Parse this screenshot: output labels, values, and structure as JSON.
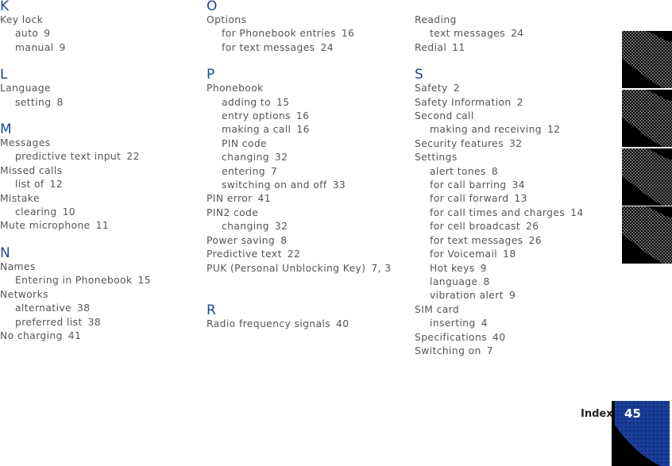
{
  "columns": [
    {
      "sections": [
        {
          "letter": "K",
          "entries": [
            {
              "text": "Key lock",
              "page": "",
              "level": 0
            },
            {
              "text": "auto",
              "page": "9",
              "level": 1
            },
            {
              "text": "manual",
              "page": "9",
              "level": 1
            }
          ]
        },
        {
          "letter": "L",
          "entries": [
            {
              "text": "Language",
              "page": "",
              "level": 0
            },
            {
              "text": "setting",
              "page": "8",
              "level": 1
            }
          ]
        },
        {
          "letter": "M",
          "entries": [
            {
              "text": "Messages",
              "page": "",
              "level": 0
            },
            {
              "text": "predictive text input",
              "page": "22",
              "level": 1
            },
            {
              "text": "Missed calls",
              "page": "",
              "level": 0
            },
            {
              "text": "list of",
              "page": "12",
              "level": 1
            },
            {
              "text": "Mistake",
              "page": "",
              "level": 0
            },
            {
              "text": "clearing",
              "page": "10",
              "level": 1
            },
            {
              "text": "Mute microphone",
              "page": "11",
              "level": 0
            }
          ]
        },
        {
          "letter": "N",
          "entries": [
            {
              "text": "Names",
              "page": "",
              "level": 0
            },
            {
              "text": "Entering in Phonebook",
              "page": "15",
              "level": 1
            },
            {
              "text": "Networks",
              "page": "",
              "level": 0
            },
            {
              "text": "alternative",
              "page": "38",
              "level": 1
            },
            {
              "text": "preferred list",
              "page": "38",
              "level": 1
            },
            {
              "text": "No charging",
              "page": "41",
              "level": 0
            }
          ]
        }
      ]
    },
    {
      "sections": [
        {
          "letter": "O",
          "entries": [
            {
              "text": "Options",
              "page": "",
              "level": 0
            },
            {
              "text": "for Phonebook entries",
              "page": "16",
              "level": 1
            },
            {
              "text": "for text messages",
              "page": "24",
              "level": 1
            }
          ]
        },
        {
          "letter": "P",
          "entries": [
            {
              "text": "Phonebook",
              "page": "",
              "level": 0
            },
            {
              "text": "adding to",
              "page": "15",
              "level": 1
            },
            {
              "text": "entry options",
              "page": "16",
              "level": 1
            },
            {
              "text": "making a call",
              "page": "16",
              "level": 1
            },
            {
              "text": "PIN code",
              "page": "",
              "level": 1
            },
            {
              "text": "changing",
              "page": "32",
              "level": 1
            },
            {
              "text": "entering",
              "page": "7",
              "level": 1
            },
            {
              "text": "switching on and off",
              "page": "33",
              "level": 1
            },
            {
              "text": "PIN error",
              "page": "41",
              "level": 0
            },
            {
              "text": "PIN2 code",
              "page": "",
              "level": 0
            },
            {
              "text": "changing",
              "page": "32",
              "level": 1
            },
            {
              "text": "Power saving",
              "page": "8",
              "level": 0
            },
            {
              "text": "Predictive text",
              "page": "22",
              "level": 0
            },
            {
              "text": "PUK (Personal Unblocking Key)",
              "page": "7, 3",
              "level": 0
            }
          ]
        },
        {
          "letter": "R",
          "entries": [
            {
              "text": "Radio frequency signals",
              "page": "40",
              "level": 0
            }
          ]
        }
      ]
    },
    {
      "sections": [
        {
          "letter": "",
          "entries": [
            {
              "text": "Reading",
              "page": "",
              "level": 0
            },
            {
              "text": "text messages",
              "page": "24",
              "level": 1
            },
            {
              "text": "Redial",
              "page": "11",
              "level": 0
            }
          ]
        },
        {
          "letter": "S",
          "entries": [
            {
              "text": "Safety",
              "page": "2",
              "level": 0
            },
            {
              "text": "Safety Information",
              "page": "2",
              "level": 0
            },
            {
              "text": "Second call",
              "page": "",
              "level": 0
            },
            {
              "text": "making and receiving",
              "page": "12",
              "level": 1
            },
            {
              "text": "Security features",
              "page": "32",
              "level": 0
            },
            {
              "text": "Settings",
              "page": "",
              "level": 0
            },
            {
              "text": "alert tones",
              "page": "8",
              "level": 1
            },
            {
              "text": "for call barring",
              "page": "34",
              "level": 1
            },
            {
              "text": "for call forward",
              "page": "13",
              "level": 1
            },
            {
              "text": "for call times and charges",
              "page": "14",
              "level": 1
            },
            {
              "text": "for cell broadcast",
              "page": "26",
              "level": 1
            },
            {
              "text": "for text messages",
              "page": "26",
              "level": 1
            },
            {
              "text": "for Voicemail",
              "page": "18",
              "level": 1
            },
            {
              "text": "Hot keys",
              "page": "9",
              "level": 1
            },
            {
              "text": "language",
              "page": "8",
              "level": 1
            },
            {
              "text": "vibration alert",
              "page": "9",
              "level": 1
            },
            {
              "text": "SIM card",
              "page": "",
              "level": 0
            },
            {
              "text": "inserting",
              "page": "4",
              "level": 1
            },
            {
              "text": "Specifications",
              "page": "40",
              "level": 0
            },
            {
              "text": "Switching on",
              "page": "7",
              "level": 0
            }
          ]
        }
      ]
    }
  ],
  "footer": {
    "section_label": "Index",
    "page_number": "45"
  },
  "colors": {
    "letter_heading": "#1a4a96",
    "body_text": "#555555",
    "tab_pattern": "#6a6a6a",
    "page_tab_pattern": "#1a3f9a"
  },
  "thumb_tabs": {
    "count": 4,
    "active_index": null
  }
}
